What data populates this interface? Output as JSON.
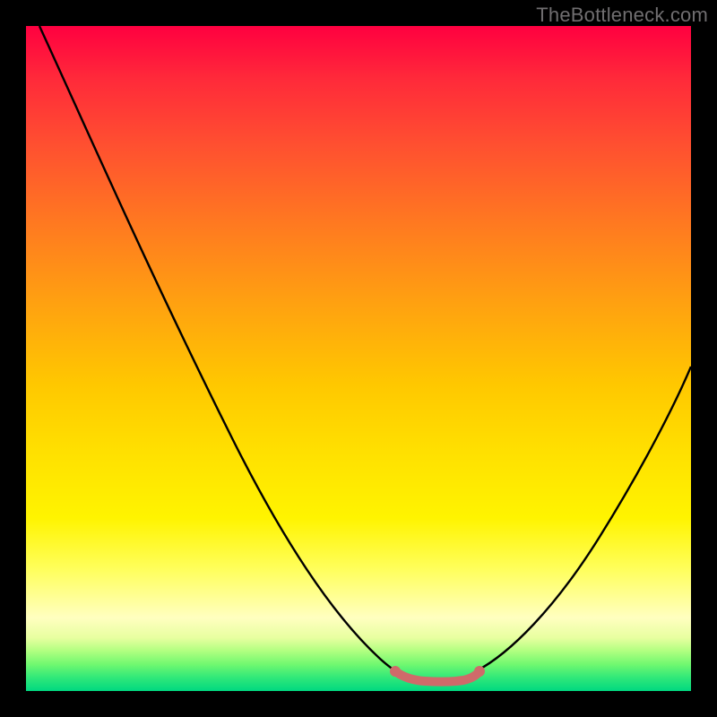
{
  "watermark": "TheBottleneck.com",
  "colors": {
    "frame": "#000000",
    "curve": "#000000",
    "highlight": "#cf6a6a"
  },
  "chart_data": {
    "type": "line",
    "title": "",
    "xlabel": "",
    "ylabel": "",
    "xlim": [
      0,
      100
    ],
    "ylim": [
      0,
      100
    ],
    "grid": false,
    "series": [
      {
        "name": "left-curve",
        "x": [
          2,
          10,
          20,
          30,
          40,
          47,
          52,
          55
        ],
        "y": [
          100,
          82,
          59,
          39,
          20,
          8,
          2,
          0
        ]
      },
      {
        "name": "valley-highlight",
        "x": [
          55,
          57,
          59,
          62,
          65,
          67,
          68
        ],
        "y": [
          0,
          0,
          0,
          0,
          0,
          0,
          1
        ]
      },
      {
        "name": "right-curve",
        "x": [
          68,
          72,
          78,
          85,
          92,
          100
        ],
        "y": [
          1,
          5,
          14,
          26,
          40,
          56
        ]
      }
    ],
    "legend": false
  }
}
